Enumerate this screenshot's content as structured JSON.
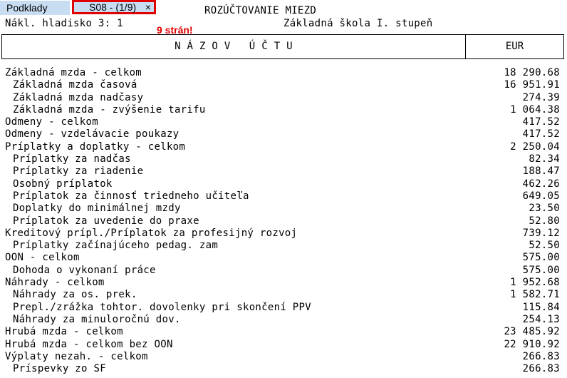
{
  "tabs": {
    "podklady": "Podklady",
    "s08": "S08 - (1/9)",
    "close": "×"
  },
  "annotation": "9 strán!",
  "report": {
    "title": "ROZÚČTOVANIE MIEZD",
    "subtitle": "Nákl. hladisko 3: 1",
    "school": "Základná škola I. stupeň",
    "col_name": "N Á Z O V   Ú Č T U",
    "col_currency": "EUR"
  },
  "rows": [
    {
      "name": "Základná mzda - celkom",
      "value": "18 290.68",
      "indent": false
    },
    {
      "name": "Základná mzda časová",
      "value": "16 951.91",
      "indent": true
    },
    {
      "name": "Základná mzda nadčasy",
      "value": "274.39",
      "indent": true
    },
    {
      "name": "Základná mzda - zvýšenie tarifu",
      "value": "1 064.38",
      "indent": true
    },
    {
      "name": "Odmeny - celkom",
      "value": "417.52",
      "indent": false
    },
    {
      "name": "Odmeny - vzdelávacie poukazy",
      "value": "417.52",
      "indent": false
    },
    {
      "name": "Príplatky a doplatky - celkom",
      "value": "2 250.04",
      "indent": false
    },
    {
      "name": "Príplatky za nadčas",
      "value": "82.34",
      "indent": true
    },
    {
      "name": "Príplatky za riadenie",
      "value": "188.47",
      "indent": true
    },
    {
      "name": "Osobný príplatok",
      "value": "462.26",
      "indent": true
    },
    {
      "name": "Príplatok za činnosť triedneho učiteľa",
      "value": "649.05",
      "indent": true
    },
    {
      "name": "Doplatky do minimálnej mzdy",
      "value": "23.50",
      "indent": true
    },
    {
      "name": "Príplatok za uvedenie do praxe",
      "value": "52.80",
      "indent": true
    },
    {
      "name": "Kreditový prípl./Príplatok za profesijný rozvoj",
      "value": "739.12",
      "indent": false
    },
    {
      "name": "Príplatky začínajúceho pedag. zam",
      "value": "52.50",
      "indent": true
    },
    {
      "name": "OON - celkom",
      "value": "575.00",
      "indent": false
    },
    {
      "name": "Dohoda o vykonaní práce",
      "value": "575.00",
      "indent": true
    },
    {
      "name": "Náhrady - celkom",
      "value": "1 952.68",
      "indent": false
    },
    {
      "name": "Náhrady za os. prek.",
      "value": "1 582.71",
      "indent": true
    },
    {
      "name": "Prepl./zrážka tohtor. dovolenky pri skončení PPV",
      "value": "115.84",
      "indent": true
    },
    {
      "name": "Náhrady za minuloročnú dov.",
      "value": "254.13",
      "indent": true
    },
    {
      "name": "Hrubá mzda - celkom",
      "value": "23 485.92",
      "indent": false
    },
    {
      "name": "Hrubá mzda - celkom bez OON",
      "value": "22 910.92",
      "indent": false
    },
    {
      "name": "Výplaty nezah. - celkom",
      "value": "266.83",
      "indent": false
    },
    {
      "name": "Príspevky zo SF",
      "value": "266.83",
      "indent": true
    }
  ]
}
